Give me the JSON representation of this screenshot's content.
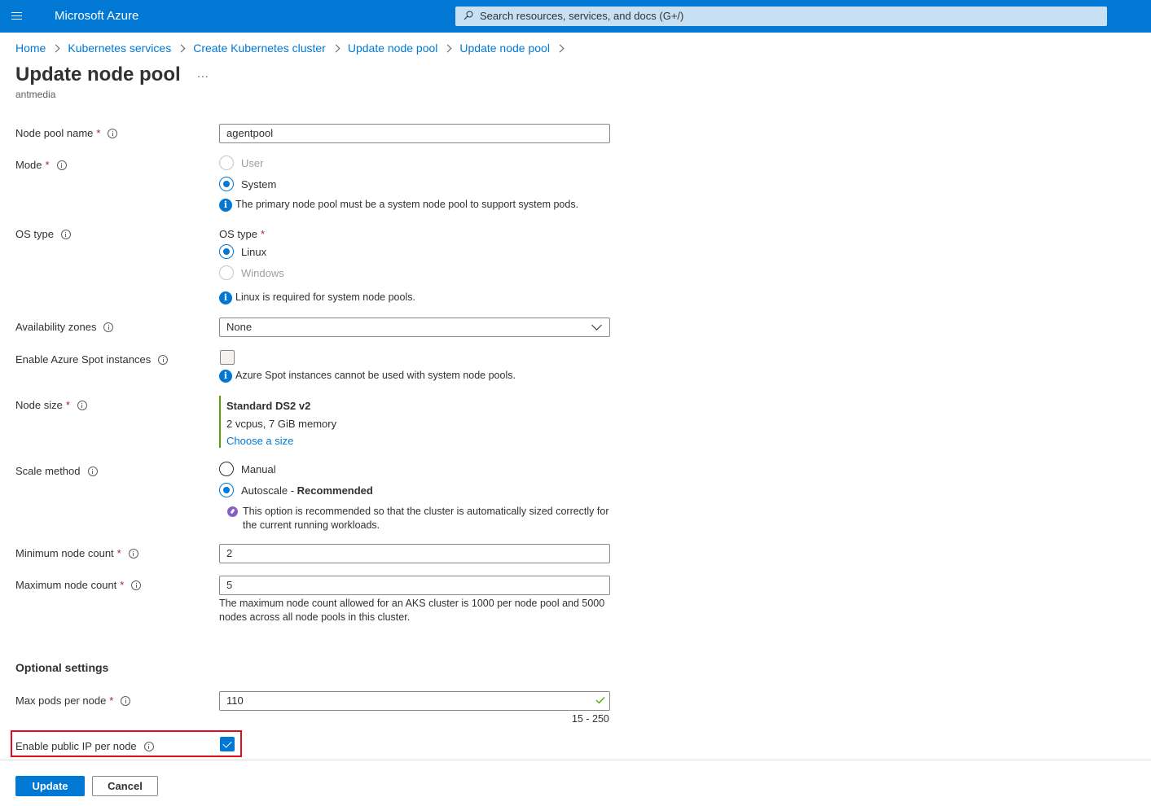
{
  "header": {
    "brand": "Microsoft Azure",
    "search_placeholder": "Search resources, services, and docs (G+/)"
  },
  "breadcrumb": [
    "Home",
    "Kubernetes services",
    "Create Kubernetes cluster",
    "Update node pool",
    "Update node pool"
  ],
  "page": {
    "title": "Update node pool",
    "ellipsis": "...",
    "subtitle": "antmedia"
  },
  "form": {
    "node_pool_name": {
      "label": "Node pool name",
      "required": "*",
      "value": "agentpool"
    },
    "mode": {
      "label": "Mode",
      "required": "*",
      "options": [
        "User",
        "System"
      ],
      "selected": "System",
      "info": "The primary node pool must be a system node pool to support system pods."
    },
    "os_type": {
      "label": "OS type",
      "inner_label": "OS type",
      "required": "*",
      "options": [
        "Linux",
        "Windows"
      ],
      "selected": "Linux",
      "info": "Linux is required for system node pools."
    },
    "availability_zones": {
      "label": "Availability zones",
      "value": "None"
    },
    "spot": {
      "label": "Enable Azure Spot instances",
      "checked": false,
      "info": "Azure Spot instances cannot be used with system node pools."
    },
    "node_size": {
      "label": "Node size",
      "required": "*",
      "name": "Standard DS2 v2",
      "spec": "2 vcpus, 7 GiB memory",
      "link": "Choose a size"
    },
    "scale_method": {
      "label": "Scale method",
      "options": [
        "Manual",
        "Autoscale - "
      ],
      "recommended": "Recommended",
      "selected": "Autoscale",
      "note": "This option is recommended so that the cluster is automatically sized correctly for the current running workloads."
    },
    "min_count": {
      "label": "Minimum node count",
      "required": "*",
      "value": "2"
    },
    "max_count": {
      "label": "Maximum node count",
      "required": "*",
      "value": "5",
      "help": "The maximum node count allowed for an AKS cluster is 1000 per node pool and 5000 nodes across all node pools in this cluster."
    },
    "optional_title": "Optional settings",
    "max_pods": {
      "label": "Max pods per node",
      "required": "*",
      "value": "110",
      "range": "15 - 250"
    },
    "public_ip": {
      "label": "Enable public IP per node",
      "checked": true
    }
  },
  "footer": {
    "update": "Update",
    "cancel": "Cancel"
  },
  "colors": {
    "accent": "#0078d4",
    "highlight": "#e00b1c",
    "success": "#57a300",
    "required": "#a4262c"
  }
}
